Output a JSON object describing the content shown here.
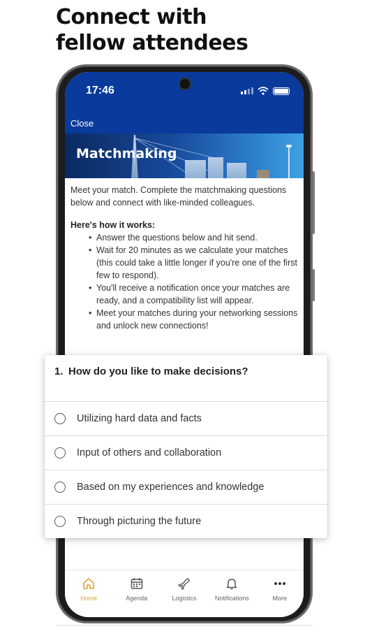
{
  "headline": {
    "line1": "Connect with",
    "line2": "fellow attendees"
  },
  "status_bar": {
    "time": "17:46"
  },
  "nav": {
    "close_label": "Close"
  },
  "banner": {
    "title": "Matchmaking"
  },
  "content": {
    "intro": "Meet your match. Complete the matchmaking questions below and connect with like-minded colleagues.",
    "how_title": "Here's how it works:",
    "steps": [
      "Answer the questions below and hit send.",
      "Wait for 20 minutes as we calculate your matches (this could take a little longer if you're one of the first few to respond).",
      "You'll receive a notification once your matches are ready, and a compatibility list will appear.",
      "Meet your matches during your networking sessions and unlock new connections!"
    ]
  },
  "question": {
    "number": "1.",
    "text": "How do you like to make decisions?",
    "options": [
      "Utilizing hard data and facts",
      "Input of others and collaboration",
      "Based on my experiences and knowledge",
      "Through picturing the future"
    ]
  },
  "tabs": [
    {
      "label": "Home",
      "icon": "home-icon",
      "active": true
    },
    {
      "label": "Agenda",
      "icon": "calendar-icon",
      "active": false
    },
    {
      "label": "Logistics",
      "icon": "plane-icon",
      "active": false
    },
    {
      "label": "Notifications",
      "icon": "bell-icon",
      "active": false
    },
    {
      "label": "More",
      "icon": "more-icon",
      "active": false
    }
  ],
  "colors": {
    "header_blue": "#0a3a9c",
    "active_tab": "#e2a23a"
  }
}
